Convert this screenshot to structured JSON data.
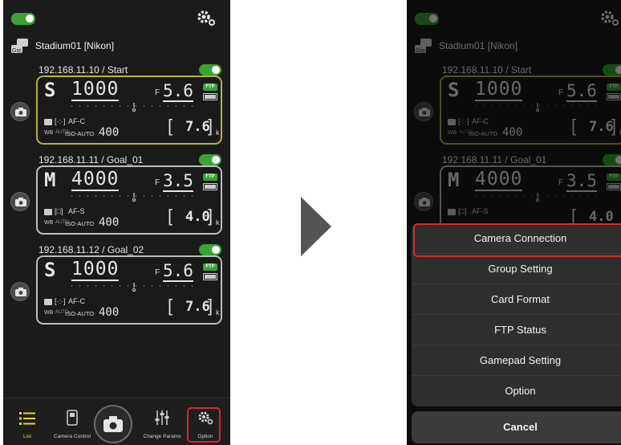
{
  "group": {
    "name": "Stadium01 [Nikon]"
  },
  "cameras": [
    {
      "title": "192.168.11.10 / Start",
      "mode": "S",
      "shutter": "1000",
      "fprefix": "F",
      "fstop": "5.6",
      "af_area": "[·:·]",
      "af_mode": "AF-C",
      "wb": "WB",
      "wb_sub": "AUTO",
      "iso_label": "ISO-AUTO",
      "iso": "400",
      "shots": "7.6",
      "shots_unit": "k",
      "ftp": "FTP"
    },
    {
      "title": "192.168.11.11 / Goal_01",
      "mode": "M",
      "shutter": "4000",
      "fprefix": "F",
      "fstop": "3.5",
      "af_area": "[□]",
      "af_mode": "AF-S",
      "wb": "WB",
      "wb_sub": "AUTO",
      "iso_label": "ISO-AUTO",
      "iso": "400",
      "shots": "4.0",
      "shots_unit": "k",
      "ftp": "FTP"
    },
    {
      "title": "192.168.11.12 / Goal_02",
      "mode": "S",
      "shutter": "1000",
      "fprefix": "F",
      "fstop": "5.6",
      "af_area": "[·:·]",
      "af_mode": "AF-C",
      "wb": "WB",
      "wb_sub": "AUTO",
      "iso_label": "ISO-AUTO",
      "iso": "400",
      "shots": "7.6",
      "shots_unit": "k",
      "ftp": "FTP"
    }
  ],
  "nav": {
    "list": "List",
    "camera_control": "Camera Control",
    "change_params": "Change Params",
    "option": "Option"
  },
  "option_menu": {
    "items": [
      "Camera Connection",
      "Group Setting",
      "Card Format",
      "FTP Status",
      "Gamepad Setting",
      "Option"
    ],
    "cancel": "Cancel"
  },
  "colors": {
    "accent_green": "#3aa335",
    "highlight_red": "#d8252b",
    "active_yellow": "#e3d23a"
  }
}
